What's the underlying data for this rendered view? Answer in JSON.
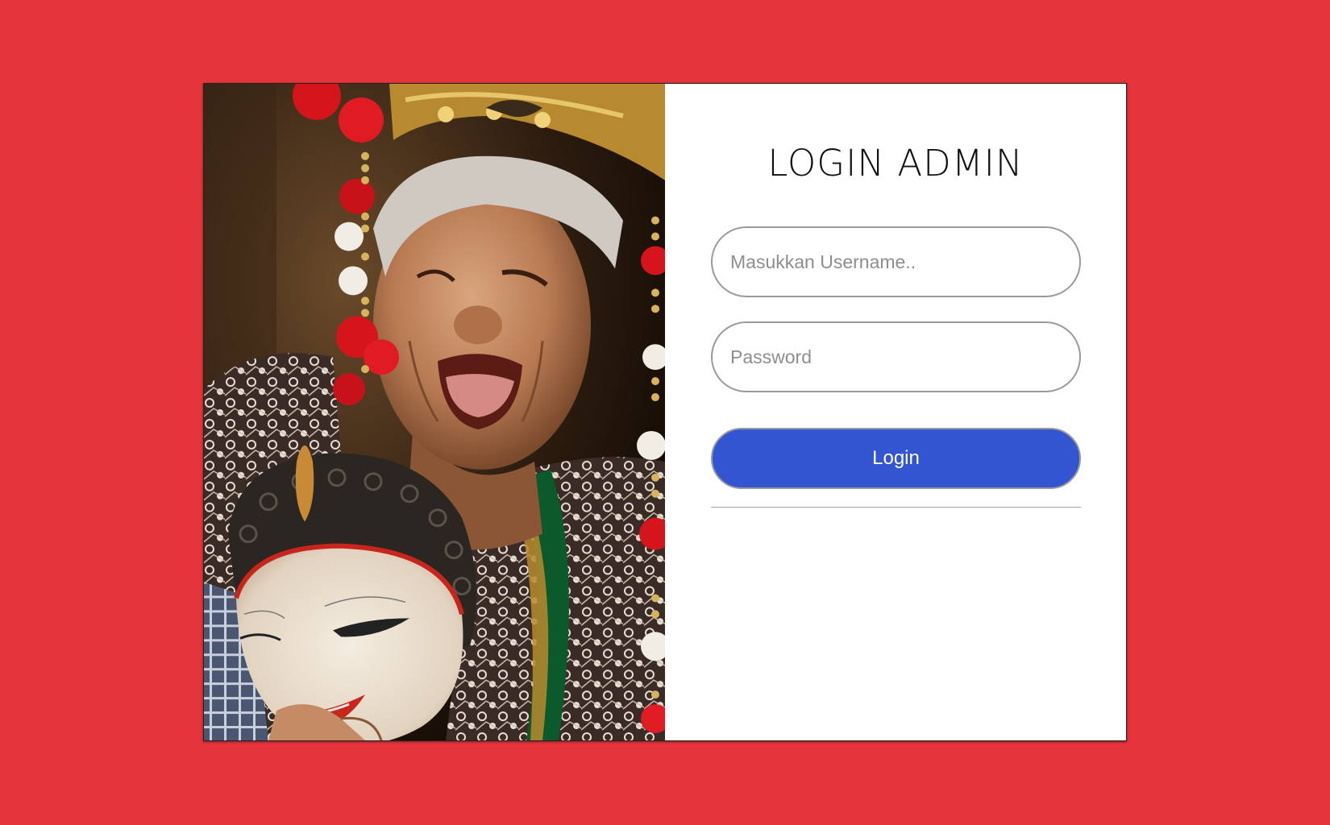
{
  "page": {
    "background_color": "#e6343c"
  },
  "photo": {
    "icon": "photo-traditional-dancer-with-mask"
  },
  "login": {
    "title": "LOGIN ADMIN",
    "username_placeholder": "Masukkan Username..",
    "username_value": "",
    "password_placeholder": "Password",
    "password_value": "",
    "button_label": "Login",
    "button_color": "#3355d1"
  }
}
